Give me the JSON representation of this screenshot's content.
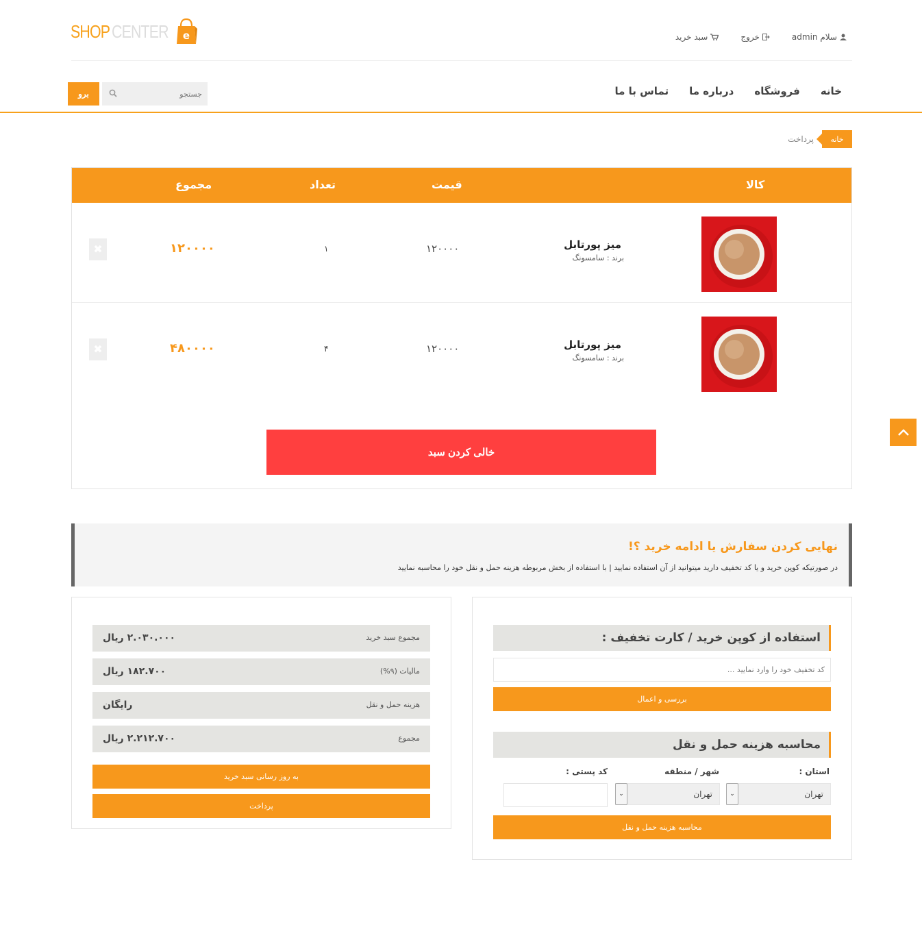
{
  "brand": {
    "logo_part1": "SHOP",
    "logo_part2": "CENTER",
    "logo_badge": "e"
  },
  "toplinks": {
    "user": "سلام admin",
    "logout": "خروج",
    "cart": "سبد خرید"
  },
  "nav": {
    "items": [
      "خانه",
      "فروشگاه",
      "درباره ما",
      "تماس با ما"
    ]
  },
  "search": {
    "placeholder": "جستجو",
    "button": "برو"
  },
  "breadcrumb": {
    "home": "خانه",
    "current": "پرداخت"
  },
  "cart": {
    "headers": {
      "product": "کالا",
      "price": "قیمت",
      "quantity": "تعداد",
      "total": "مجموع"
    },
    "rows": [
      {
        "name": "میز پورتابل",
        "brand": "برند : سامسونگ",
        "price": "۱۲۰۰۰۰",
        "qty": "۱",
        "total": "۱۲۰۰۰۰"
      },
      {
        "name": "میز پورتابل",
        "brand": "برند : سامسونگ",
        "price": "۱۲۰۰۰۰",
        "qty": "۴",
        "total": "۴۸۰۰۰۰"
      }
    ],
    "empty_button": "خالی کردن سبد"
  },
  "finalize": {
    "title": "نهایی کردن سفارش یا ادامه خرید ؟!",
    "text": "در صورتیکه کوپن خرید و یا کد تخفیف دارید میتوانید از آن استفاده نمایید | با استفاده از بخش مربوطه هزینه حمل و نقل خود را محاسبه نمایید"
  },
  "totals": {
    "rows": [
      {
        "label": "مجموع سبد خرید",
        "value": "۲.۰۳۰.۰۰۰ ریال"
      },
      {
        "label": "مالیات (۹%)",
        "value": "۱۸۲.۷۰۰ ریال"
      },
      {
        "label": "هزینه حمل و نقل",
        "value": "رایگان"
      },
      {
        "label": "مجموع",
        "value": "۲.۲۱۲.۷۰۰ ریال"
      }
    ],
    "update_button": "به روز رسانی سبد خرید",
    "pay_button": "پرداخت"
  },
  "coupon": {
    "title": "استفاده از کوپن خرید / کارت تخفیف :",
    "placeholder": "کد تخفیف خود را وارد نمایید ...",
    "apply_button": "بررسی و اعمال"
  },
  "shipping": {
    "title": "محاسبه هزینه حمل و نقل",
    "province_label": "استان :",
    "city_label": "شهر / منطقه",
    "postal_label": "کد پستی :",
    "province_value": "تهران",
    "city_value": "تهران",
    "calc_button": "محاسبه هزینه حمل و نقل"
  },
  "colors": {
    "accent": "#f7981c",
    "danger": "#ff3f3f",
    "panel": "#e4e4e1"
  }
}
